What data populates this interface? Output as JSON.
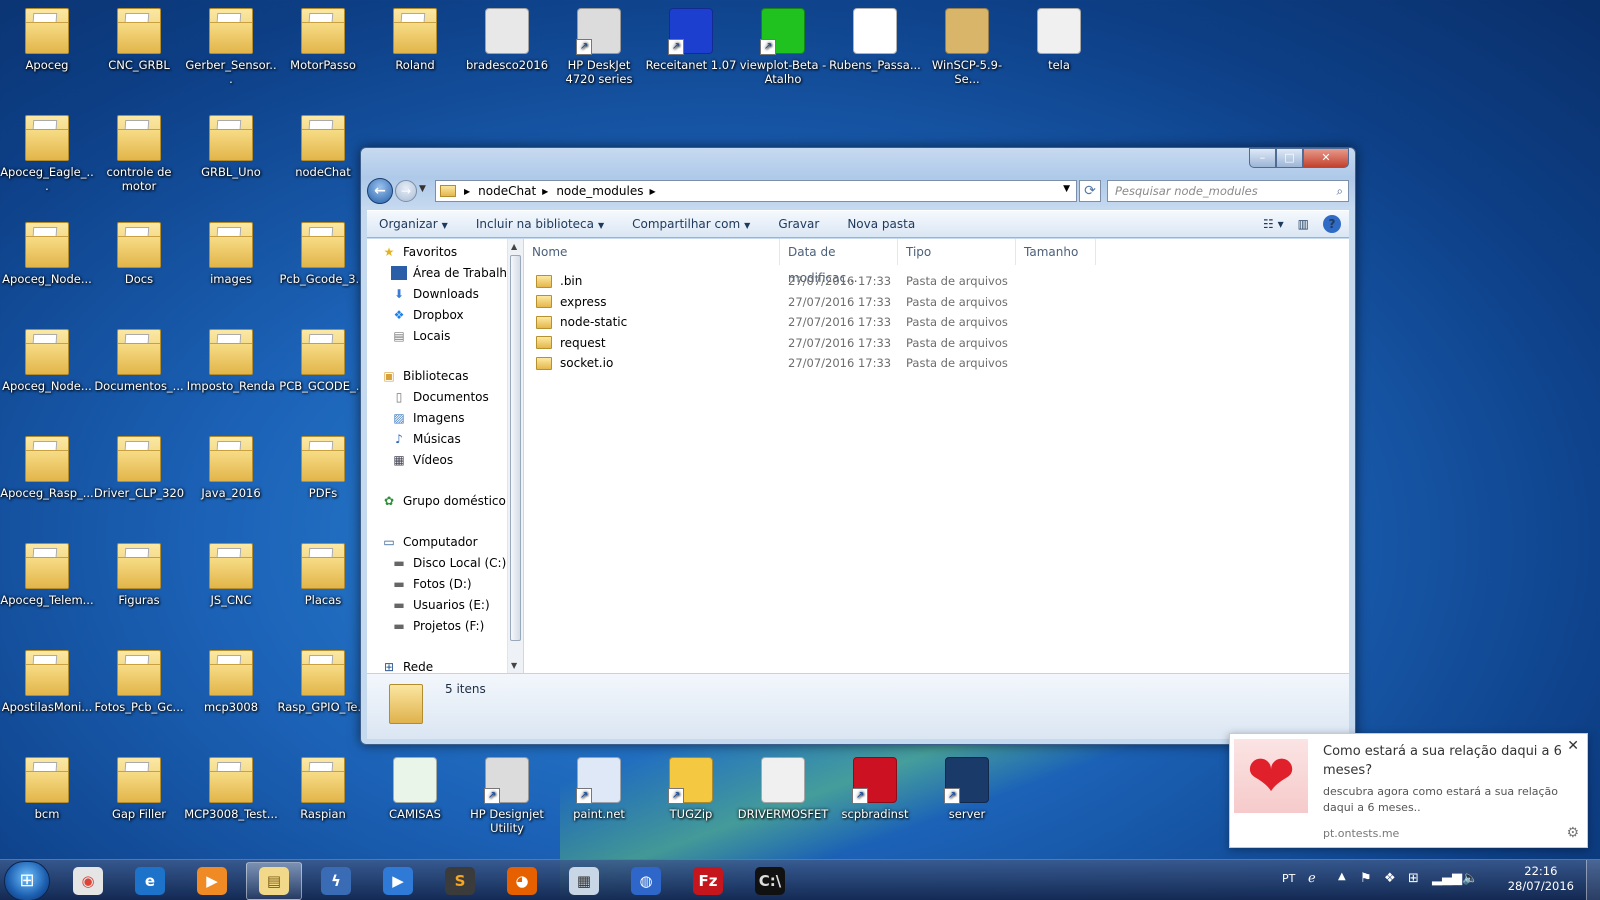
{
  "desktop": {
    "icons": [
      {
        "label": "Apoceg",
        "icon": "folder"
      },
      {
        "label": "CNC_GRBL",
        "icon": "folder"
      },
      {
        "label": "Gerber_Sensor...",
        "icon": "folder"
      },
      {
        "label": "MotorPasso",
        "icon": "folder"
      },
      {
        "label": "Roland",
        "icon": "folder"
      },
      {
        "label": "bradesco2016",
        "icon": "certificate"
      },
      {
        "label": "HP DeskJet 4720 series",
        "icon": "printer"
      },
      {
        "label": "Receitanet 1.07",
        "icon": "receitanet"
      },
      {
        "label": "viewplot-Beta - Atalho",
        "icon": "viewplot"
      },
      {
        "label": "Rubens_Passa...",
        "icon": "photo"
      },
      {
        "label": "WinSCP-5.9-Se...",
        "icon": "package"
      },
      {
        "label": "tela",
        "icon": "image"
      },
      {
        "label": "Apoceg_Eagle_...",
        "icon": "folder"
      },
      {
        "label": "controle de motor",
        "icon": "folder"
      },
      {
        "label": "GRBL_Uno",
        "icon": "folder"
      },
      {
        "label": "nodeChat",
        "icon": "folder"
      },
      {
        "label": "Apoceg_Node...",
        "icon": "folder"
      },
      {
        "label": "Docs",
        "icon": "folder"
      },
      {
        "label": "images",
        "icon": "folder"
      },
      {
        "label": "Pcb_Gcode_3...",
        "icon": "folder"
      },
      {
        "label": "Apoceg_Node...",
        "icon": "folder"
      },
      {
        "label": "Documentos_...",
        "icon": "folder"
      },
      {
        "label": "Imposto_Renda",
        "icon": "folder"
      },
      {
        "label": "PCB_GCODE_...",
        "icon": "folder"
      },
      {
        "label": "Apoceg_Rasp_...",
        "icon": "folder"
      },
      {
        "label": "Driver_CLP_320",
        "icon": "folder"
      },
      {
        "label": "Java_2016",
        "icon": "folder"
      },
      {
        "label": "PDFs",
        "icon": "folder"
      },
      {
        "label": "Apoceg_Telem...",
        "icon": "folder"
      },
      {
        "label": "Figuras",
        "icon": "folder"
      },
      {
        "label": "JS_CNC",
        "icon": "folder"
      },
      {
        "label": "Placas",
        "icon": "folder"
      },
      {
        "label": "ApostilasMoni...",
        "icon": "folder"
      },
      {
        "label": "Fotos_Pcb_Gc...",
        "icon": "folder"
      },
      {
        "label": "mcp3008",
        "icon": "folder"
      },
      {
        "label": "Rasp_GPIO_Te...",
        "icon": "folder"
      },
      {
        "label": "bcm",
        "icon": "folder"
      },
      {
        "label": "Gap Filler",
        "icon": "folder"
      },
      {
        "label": "MCP3008_Test...",
        "icon": "folder"
      },
      {
        "label": "Raspian",
        "icon": "folder"
      },
      {
        "label": "CAMISAS",
        "icon": "spreadsheet"
      },
      {
        "label": "HP Designjet Utility",
        "icon": "printer"
      },
      {
        "label": "paint.net",
        "icon": "paint"
      },
      {
        "label": "TUGZip",
        "icon": "zip"
      },
      {
        "label": "DRIVERMOSFET",
        "icon": "image"
      },
      {
        "label": "scpbradinst",
        "icon": "bradesco"
      },
      {
        "label": "server",
        "icon": "monitor"
      }
    ]
  },
  "explorer": {
    "window_buttons": {
      "minimize": "–",
      "maximize": "□",
      "close": "✕"
    },
    "breadcrumb": [
      "nodeChat",
      "node_modules"
    ],
    "search_placeholder": "Pesquisar node_modules",
    "commands": [
      "Organizar",
      "Incluir na biblioteca",
      "Compartilhar com",
      "Gravar",
      "Nova pasta"
    ],
    "nav": {
      "favorites": "Favoritos",
      "favorites_items": [
        "Área de Trabalho",
        "Downloads",
        "Dropbox",
        "Locais"
      ],
      "libraries": "Bibliotecas",
      "libraries_items": [
        "Documentos",
        "Imagens",
        "Músicas",
        "Vídeos"
      ],
      "homegroup": "Grupo doméstico",
      "computer": "Computador",
      "computer_items": [
        "Disco Local (C:)",
        "Fotos (D:)",
        "Usuarios (E:)",
        "Projetos (F:)"
      ],
      "network": "Rede"
    },
    "columns": [
      "Nome",
      "Data de modificaç...",
      "Tipo",
      "Tamanho"
    ],
    "files": [
      {
        "name": ".bin",
        "date": "27/07/2016 17:33",
        "type": "Pasta de arquivos"
      },
      {
        "name": "express",
        "date": "27/07/2016 17:33",
        "type": "Pasta de arquivos"
      },
      {
        "name": "node-static",
        "date": "27/07/2016 17:33",
        "type": "Pasta de arquivos"
      },
      {
        "name": "request",
        "date": "27/07/2016 17:33",
        "type": "Pasta de arquivos"
      },
      {
        "name": "socket.io",
        "date": "27/07/2016 17:33",
        "type": "Pasta de arquivos"
      }
    ],
    "item_count": "5 itens"
  },
  "toast": {
    "title": "Como estará a sua relação daqui a 6 meses?",
    "body": "descubra agora como estará a sua relação daqui a 6 meses..",
    "site": "pt.ontests.me"
  },
  "taskbar": {
    "apps": [
      "chrome",
      "internet-explorer",
      "media-player",
      "file-explorer",
      "flash",
      "windows-media",
      "sublime",
      "firefox",
      "calculator",
      "google-earth",
      "filezilla",
      "command-prompt"
    ],
    "active_app": "file-explorer",
    "language": "PT",
    "time": "22:16",
    "date": "28/07/2016"
  },
  "colors": {
    "accent": "#1c63b8",
    "close": "#c2422d",
    "heart": "#e0202a"
  }
}
